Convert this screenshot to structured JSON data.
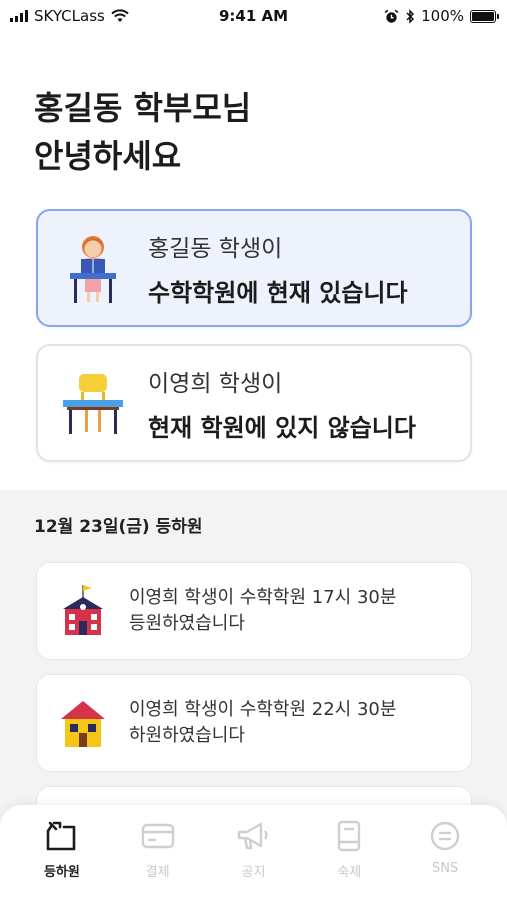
{
  "status_bar": {
    "carrier": "SKYCLass",
    "time": "9:41 AM",
    "battery": "100%",
    "icons": [
      "signal-icon",
      "wifi-icon",
      "alarm-icon",
      "bluetooth-icon",
      "battery-icon"
    ]
  },
  "greeting": {
    "line1": "홍길동 학부모님",
    "line2": "안녕하세요"
  },
  "students": [
    {
      "name": "홍길동 학생이",
      "status": "수학학원에 현재 있습니다",
      "present": true,
      "icon": "student-studying-icon"
    },
    {
      "name": "이영희 학생이",
      "status": "현재 학원에 있지 않습니다",
      "present": false,
      "icon": "empty-desk-icon"
    }
  ],
  "history": {
    "date_title": "12월 23일(금) 등하원",
    "items": [
      {
        "line1": "이영희 학생이 수학학원 17시 30분",
        "line2": "등원하였습니다",
        "icon": "school-building-icon"
      },
      {
        "line1": "이영희 학생이 수학학원 22시 30분",
        "line2": "하원하였습니다",
        "icon": "house-icon"
      }
    ]
  },
  "nav": {
    "items": [
      {
        "label": "등하원",
        "icon": "attendance-icon",
        "active": true
      },
      {
        "label": "결제",
        "icon": "card-icon",
        "active": false
      },
      {
        "label": "공지",
        "icon": "megaphone-icon",
        "active": false
      },
      {
        "label": "숙제",
        "icon": "book-icon",
        "active": false
      },
      {
        "label": "SNS",
        "icon": "chat-icon",
        "active": false
      }
    ]
  },
  "colors": {
    "active_card_border": "#8aa4ee",
    "active_card_bg": "#eef2fd",
    "section_bg": "#f3f3f3",
    "nav_inactive": "#c8c8c8"
  }
}
